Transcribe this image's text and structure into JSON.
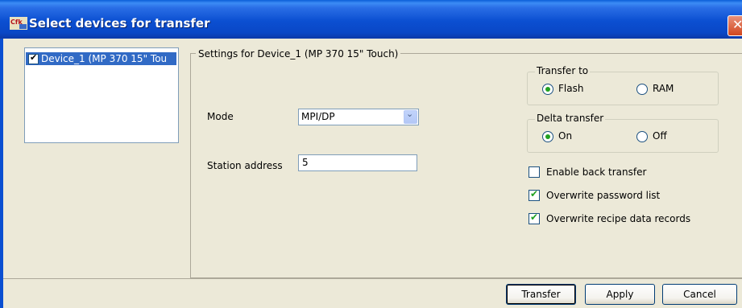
{
  "window": {
    "title": "Select devices for transfer",
    "app_icon": "Cfk"
  },
  "device_list": {
    "items": [
      {
        "label": "Device_1 (MP 370 15\" Tou",
        "checked": true,
        "selected": true
      }
    ]
  },
  "settings": {
    "group_label": "Settings for Device_1 (MP 370 15\" Touch)",
    "mode_label": "Mode",
    "mode_value": "MPI/DP",
    "station_label": "Station address",
    "station_value": "5"
  },
  "transfer_to": {
    "legend": "Transfer to",
    "flash_label": "Flash",
    "ram_label": "RAM",
    "selected": "Flash"
  },
  "delta_transfer": {
    "legend": "Delta transfer",
    "on_label": "On",
    "off_label": "Off",
    "selected": "On"
  },
  "options": {
    "enable_back_transfer": {
      "label": "Enable back transfer",
      "checked": false
    },
    "overwrite_password_list": {
      "label": "Overwrite password list",
      "checked": true
    },
    "overwrite_recipe": {
      "label": "Overwrite recipe data records",
      "checked": true
    }
  },
  "buttons": {
    "transfer": "Transfer",
    "apply": "Apply",
    "cancel": "Cancel"
  },
  "colors": {
    "title_bar": "#0b4fd1",
    "selection": "#316ac5",
    "dialog_bg": "#ece9d8",
    "radio_check": "#21a121"
  }
}
